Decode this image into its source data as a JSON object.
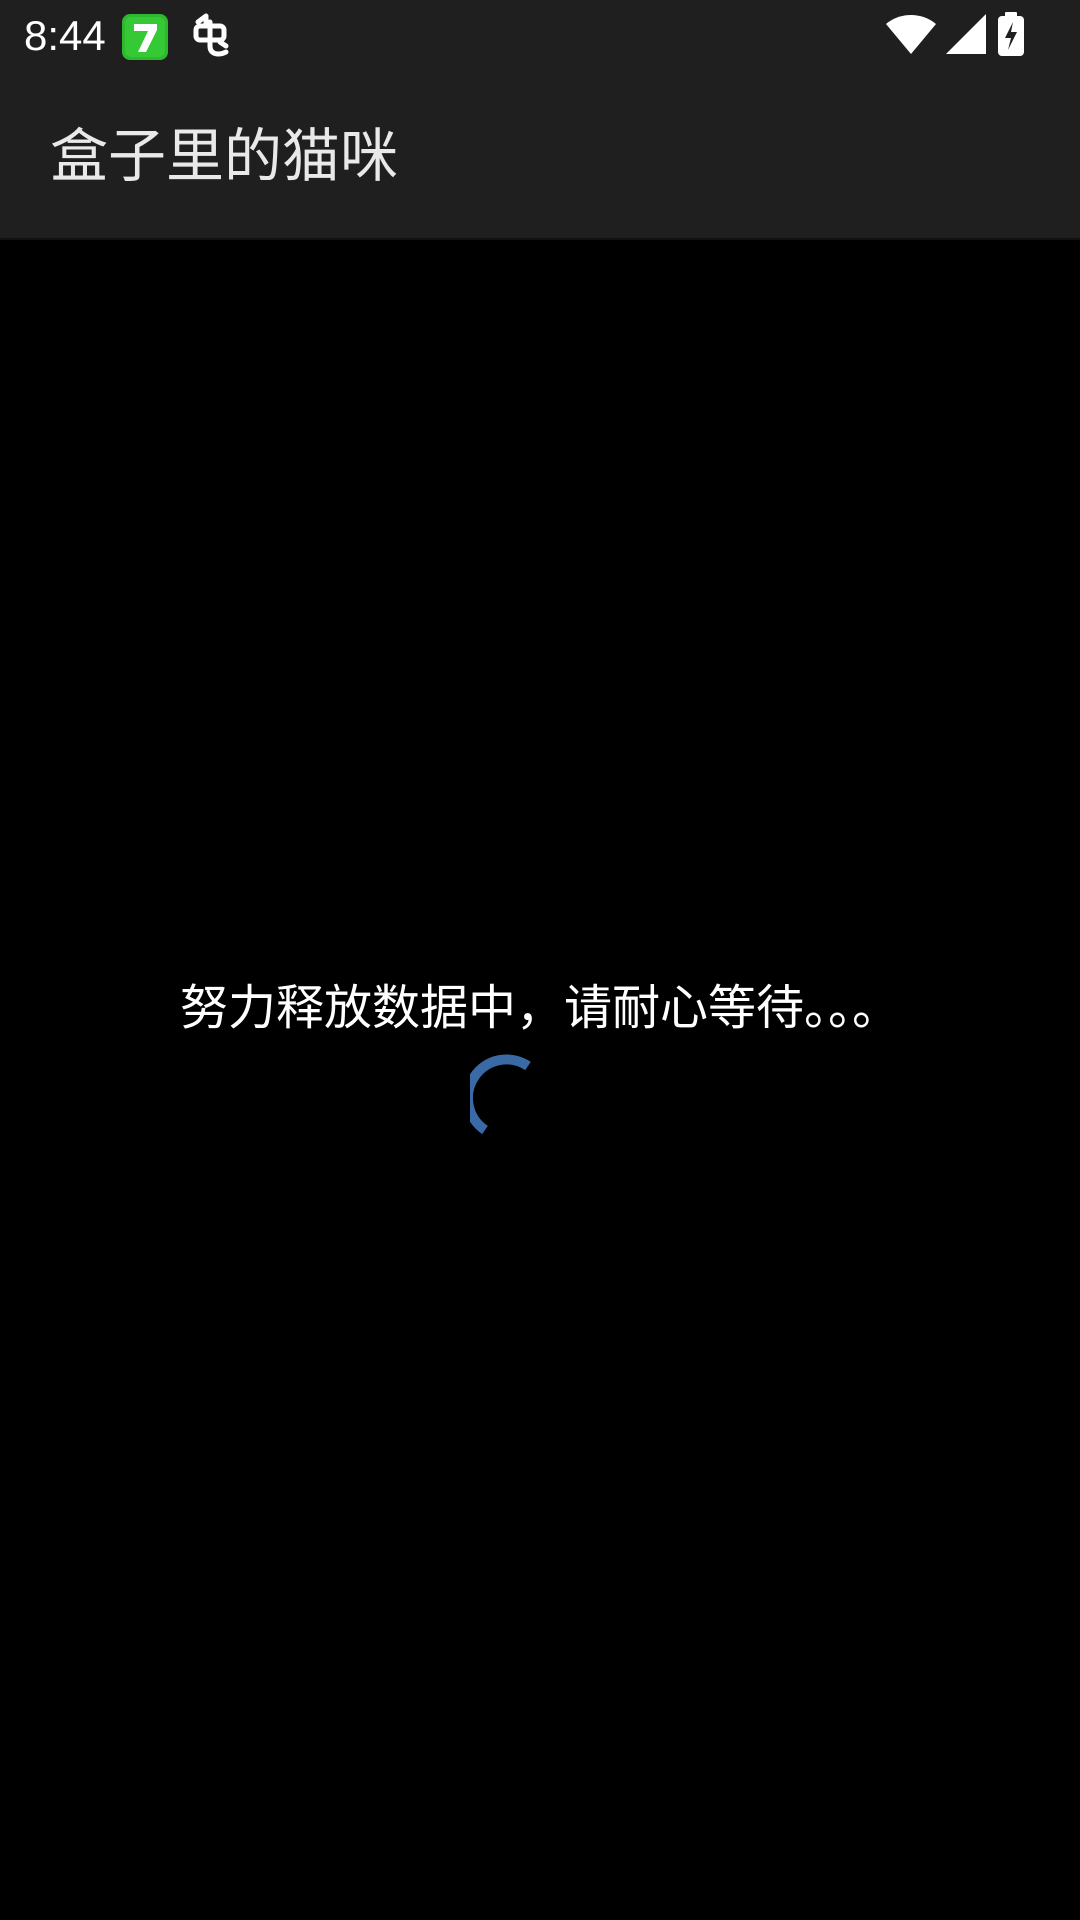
{
  "status_bar": {
    "time": "8:44",
    "icons": [
      "seven-app-icon",
      "chong-app-icon",
      "wifi-icon",
      "cell-signal-icon",
      "battery-charging-icon"
    ]
  },
  "app_bar": {
    "title": "盒子里的猫咪"
  },
  "loading": {
    "message": "努力释放数据中，请耐心等待。。。",
    "spinner_color": "#3a6aa6"
  },
  "colors": {
    "status_bg": "#1f1f1f",
    "content_bg": "#000000",
    "text": "#ffffff"
  }
}
